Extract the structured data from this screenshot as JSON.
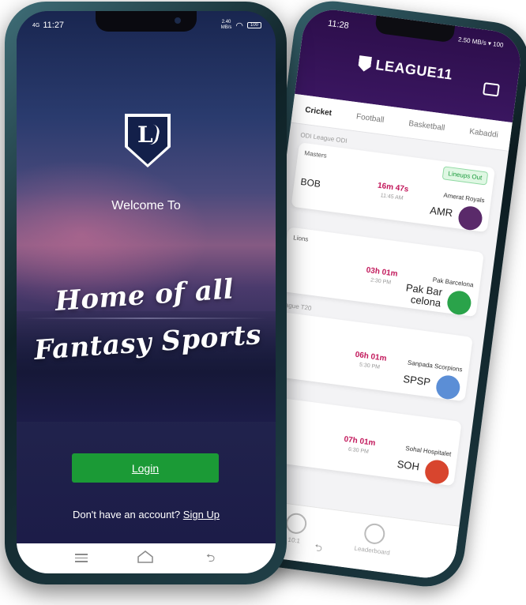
{
  "back_phone": {
    "status": {
      "time": "11:28",
      "speed": "2.50 MB/s",
      "battery": "100"
    },
    "app_name": "LEAGUE11",
    "tabs": [
      "Cricket",
      "Football",
      "Basketball",
      "Kabaddi"
    ],
    "matches": [
      {
        "league": "ODI League ODI",
        "title": "Masters",
        "badge": "Lineups Out",
        "team1": "BOB",
        "countdown": "16m 47s",
        "time": "11:45 AM",
        "team2_name": "Amerat Royals",
        "team2_code": "AMR",
        "team2_color": "#5a2a6a"
      },
      {
        "league": "",
        "title": "Lions",
        "badge": "",
        "team1": "",
        "countdown": "03h 01m",
        "time": "2:30 PM",
        "team2_name": "Pak Barcelona",
        "team2_code": "Pak Bar celona",
        "team2_color": "#2aa34a"
      },
      {
        "league": "League T20",
        "title": "",
        "badge": "",
        "team1": "",
        "countdown": "06h 01m",
        "time": "5:30 PM",
        "team2_name": "Sanpada Scorpions",
        "team2_code": "SPSP",
        "team2_color": "#5b8ed6"
      },
      {
        "league": "",
        "title": "",
        "badge": "",
        "team1": "",
        "countdown": "07h 01m",
        "time": "6:30 PM",
        "team2_name": "Sohal Hospitalet",
        "team2_code": "SOH",
        "team2_color": "#d8452e"
      }
    ],
    "bottom_nav": [
      "10:1",
      "Leaderboard"
    ]
  },
  "front_phone": {
    "status": {
      "network": "4G",
      "time": "11:27",
      "speed_value": "2.40",
      "speed_unit": "MB/s",
      "battery": "100"
    },
    "logo_letter": "L",
    "welcome": "Welcome To",
    "tagline_line1": "Home of all",
    "tagline_line2": "Fantasy Sports",
    "login_label": "Login",
    "signup_prompt": "Don't have an account?",
    "signup_link": "Sign Up",
    "colors": {
      "accent": "#1b9a36",
      "background": "#1d1d48"
    }
  }
}
